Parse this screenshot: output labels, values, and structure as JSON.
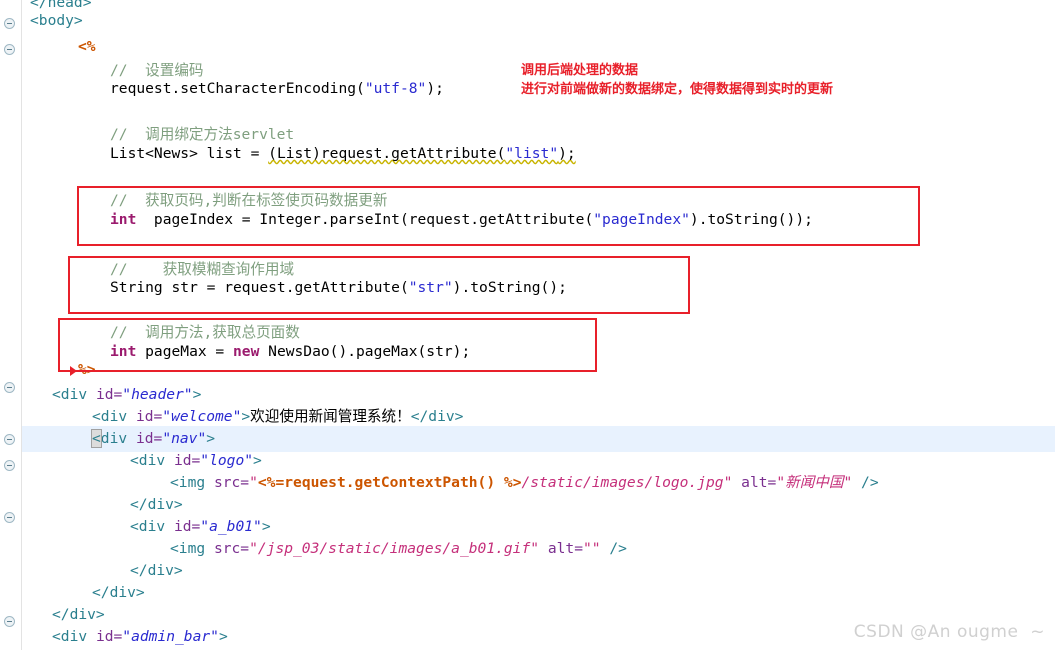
{
  "editor": {
    "watermark": "CSDN @An ougme  ~",
    "gutter_marker_icon": "fold-collapse-icon",
    "lines": [
      {
        "id": "line-head-close",
        "text": "</head>"
      },
      {
        "id": "line-body-open",
        "text": "<body>"
      },
      {
        "id": "line-scriptlet-open",
        "text": "<%"
      },
      {
        "id": "line-comment-encoding",
        "text": "// 设置编码"
      },
      {
        "id": "line-set-encoding",
        "text": "request.setCharacterEncoding(\"utf-8\");"
      },
      {
        "id": "line-comment-servlet",
        "text": "// 调用绑定方法servlet"
      },
      {
        "id": "line-list-news",
        "text": "List<News> list = (List)request.getAttribute(\"list\");"
      },
      {
        "id": "line-comment-pageindex",
        "text": "// 获取页码,判断在标签使页码数据更新"
      },
      {
        "id": "line-pageindex",
        "text": "int  pageIndex = Integer.parseInt(request.getAttribute(\"pageIndex\").toString());"
      },
      {
        "id": "line-comment-str",
        "text": "//   获取模糊查询作用域"
      },
      {
        "id": "line-str",
        "text": "String str = request.getAttribute(\"str\").toString();"
      },
      {
        "id": "line-comment-pagemax",
        "text": "// 调用方法,获取总页面数"
      },
      {
        "id": "line-pagemax",
        "text": "int pageMax = new NewsDao().pageMax(str);"
      },
      {
        "id": "line-scriptlet-close",
        "text": "%>"
      },
      {
        "id": "line-div-header",
        "text": "<div id=\"header\">"
      },
      {
        "id": "line-div-welcome",
        "text": "<div id=\"welcome\">欢迎使用新闻管理系统！</div>"
      },
      {
        "id": "line-div-nav",
        "text": "<div id=\"nav\">"
      },
      {
        "id": "line-div-logo",
        "text": "<div id=\"logo\">"
      },
      {
        "id": "line-img-logo",
        "text": "<img src=\"<%=request.getContextPath() %>/static/images/logo.jpg\" alt=\"新闻中国\" />"
      },
      {
        "id": "line-div-logo-close",
        "text": "</div>"
      },
      {
        "id": "line-div-ab01",
        "text": "<div id=\"a_b01\">"
      },
      {
        "id": "line-img-ab01",
        "text": "<img src=\"/jsp_03/static/images/a_b01.gif\" alt=\"\" />"
      },
      {
        "id": "line-div-ab01-close",
        "text": "</div>"
      },
      {
        "id": "line-div-nav-close",
        "text": "</div>"
      },
      {
        "id": "line-div-header-close",
        "text": "</div>"
      },
      {
        "id": "line-div-admin-bar",
        "text": "<div id=\"admin_bar\">"
      }
    ],
    "tokens": {
      "head_close": "</head>",
      "body_open": "<body>",
      "scriptlet_open": "<%",
      "scriptlet_close": "%>",
      "comment_encoding": "//  设置编码",
      "encoding_call_a": "request.setCharacterEncoding(",
      "encoding_str": "\"utf-8\"",
      "encoding_call_b": ");",
      "comment_servlet": "//  调用绑定方法servlet",
      "list_decl": "List<News> list = ",
      "list_cast": "(List)request.getAttribute(",
      "list_key": "\"list\"",
      "list_end": ");",
      "comment_pageindex": "//  获取页码,判断在标签使页码数据更新",
      "kw_int": "int",
      "pageindex_mid": "  pageIndex = Integer.parseInt(request.getAttribute(",
      "pageindex_key": "\"pageIndex\"",
      "pageindex_end": ").toString());",
      "comment_str": "//    获取模糊查询作用域",
      "str_decl": "String str = request.getAttribute(",
      "str_key": "\"str\"",
      "str_end": ").toString();",
      "comment_pagemax": "//  调用方法,获取总页面数",
      "pagemax_mid": " pageMax = ",
      "kw_new": "new",
      "pagemax_end": " NewsDao().pageMax(str);",
      "tag_div_open": "<div ",
      "attr_id": "id=",
      "val_header": "\"header\"",
      "gt": ">",
      "val_welcome": "\"welcome\"",
      "welcome_text": "欢迎使用新闻管理系统！",
      "tag_div_close": "</div>",
      "bracket_lt": "<",
      "tag_div_rest": "div ",
      "val_nav": "\"nav\"",
      "val_logo": "\"logo\"",
      "tag_img_open": "<img ",
      "attr_src": "src=",
      "img_logo_q1": "\"",
      "img_logo_expr": "<%=request.getContextPath() %>",
      "img_logo_path": "/static/images/logo.jpg",
      "img_logo_q2": "\"",
      "attr_alt": " alt=",
      "img_logo_alt": "\"新闻中国\"",
      "selfclose": " />",
      "val_ab01": "\"a_b01\"",
      "img_ab01_src": "\"/jsp_03/static/images/a_b01.gif\"",
      "img_ab01_alt": "\"\"",
      "val_admin_bar": "\"admin_bar\""
    }
  },
  "annotations": {
    "note_line_1": "调用后端处理的数据",
    "note_line_2": "进行对前端做新的数据绑定，使得数据得到实时的更新",
    "box_1_label": "pageIndex-highlight-box",
    "box_2_label": "str-highlight-box",
    "box_3_label": "pageMax-highlight-box"
  },
  "colors": {
    "annotation_red": "#e8202a",
    "tag": "#2a7f8e",
    "attribute": "#7a2f8f",
    "attribute_value": "#2a2ad0",
    "string_red": "#c5307b",
    "comment": "#7f9f7f",
    "keyword": "#9b1b6e",
    "scriptlet": "#cc5500",
    "highlight_line": "#e8f2fe",
    "watermark": "#d0d0d0"
  }
}
